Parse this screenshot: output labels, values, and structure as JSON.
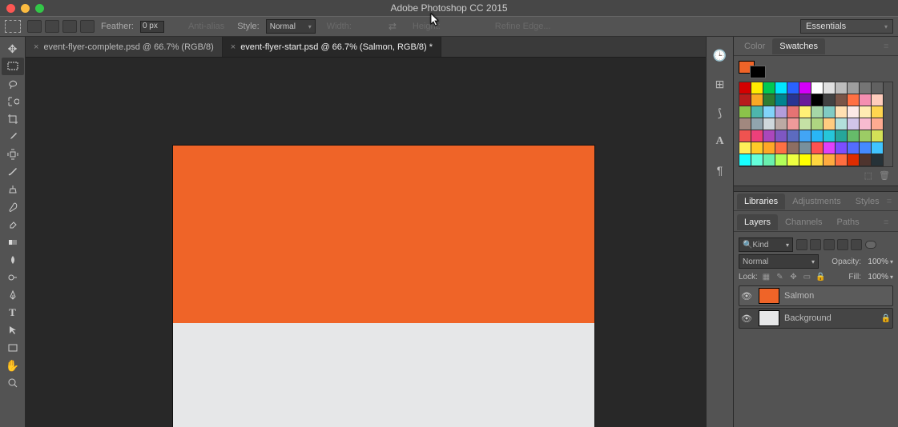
{
  "app_title": "Adobe Photoshop CC 2015",
  "options": {
    "feather_label": "Feather:",
    "feather_value": "0 px",
    "anti_alias": "Anti-alias",
    "style_label": "Style:",
    "style_value": "Normal",
    "width_label": "Width:",
    "height_label": "Height:",
    "refine": "Refine Edge...",
    "workspace": "Essentials"
  },
  "tabs": [
    {
      "label": "event-flyer-complete.psd @ 66.7% (RGB/8)",
      "active": false
    },
    {
      "label": "event-flyer-start.psd @ 66.7% (Salmon, RGB/8) *",
      "active": true
    }
  ],
  "panels": {
    "color_tab": "Color",
    "swatches_tab": "Swatches",
    "libraries_tab": "Libraries",
    "adjustments_tab": "Adjustments",
    "styles_tab": "Styles",
    "layers_tab": "Layers",
    "channels_tab": "Channels",
    "paths_tab": "Paths"
  },
  "swatch_colors_primary": [
    "#ef6428",
    "#000000"
  ],
  "swatch_grid": [
    "#d50000",
    "#ffea00",
    "#00c853",
    "#00e5ff",
    "#2962ff",
    "#d500f9",
    "#ffffff",
    "#e0e0e0",
    "#bdbdbd",
    "#9e9e9e",
    "#757575",
    "#616161",
    "#b71c1c",
    "#f9a825",
    "#2e7d32",
    "#00838f",
    "#283593",
    "#6a1b9a",
    "#000000",
    "#424242",
    "#795548",
    "#ff7043",
    "#f48fb1",
    "#ffccbc",
    "#8bc34a",
    "#4db6ac",
    "#81d4fa",
    "#b39ddb",
    "#e57373",
    "#fff176",
    "#a5d6a7",
    "#80cbc4",
    "#ffe0b2",
    "#fbe9e7",
    "#ffecb3",
    "#ffd54f",
    "#a1887f",
    "#90a4ae",
    "#cfd8dc",
    "#bcaaa4",
    "#ef9a9a",
    "#c5e1a5",
    "#aed581",
    "#ffcc80",
    "#b2dfdb",
    "#d1c4e9",
    "#f8bbd0",
    "#ffab91",
    "#ef5350",
    "#ec407a",
    "#ab47bc",
    "#7e57c2",
    "#5c6bc0",
    "#42a5f5",
    "#29b6f6",
    "#26c6da",
    "#26a69a",
    "#66bb6a",
    "#9ccc65",
    "#d4e157",
    "#ffee58",
    "#ffca28",
    "#ffa726",
    "#ff7043",
    "#8d6e63",
    "#78909c",
    "#ff5252",
    "#e040fb",
    "#7c4dff",
    "#536dfe",
    "#448aff",
    "#40c4ff",
    "#18ffff",
    "#64ffda",
    "#69f0ae",
    "#b2ff59",
    "#eeff41",
    "#ffff00",
    "#ffd740",
    "#ffab40",
    "#ff6e40",
    "#dd2c00",
    "#4e342e",
    "#263238"
  ],
  "layers": {
    "kind_icon": "🔍",
    "kind_label": "Kind",
    "blend_mode": "Normal",
    "opacity_label": "Opacity:",
    "opacity_value": "100%",
    "lock_label": "Lock:",
    "fill_label": "Fill:",
    "fill_value": "100%",
    "items": [
      {
        "name": "Salmon",
        "thumb": "#ef6428",
        "selected": true,
        "locked": false
      },
      {
        "name": "Background",
        "thumb": "#e6e7e8",
        "selected": false,
        "locked": true
      }
    ]
  }
}
